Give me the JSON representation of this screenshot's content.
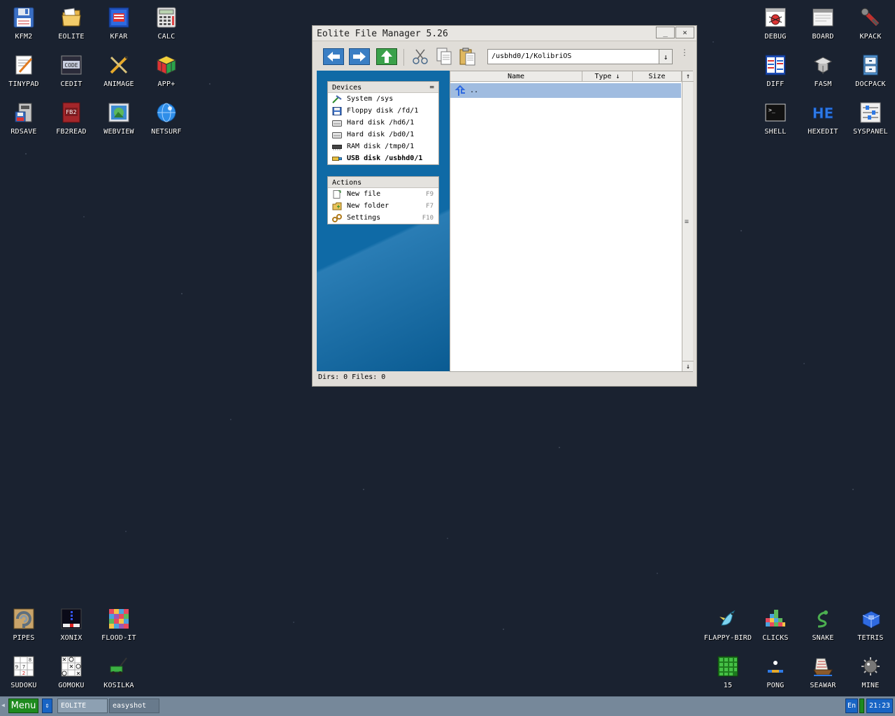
{
  "desktop": {
    "icons": [
      {
        "label": "KFM2",
        "icon": "floppy-disk-icon"
      },
      {
        "label": "EOLITE",
        "icon": "folder-icon"
      },
      {
        "label": "KFAR",
        "icon": "archive-icon"
      },
      {
        "label": "CALC",
        "icon": "calculator-icon"
      },
      {
        "label": "TINYPAD",
        "icon": "notepad-icon"
      },
      {
        "label": "CEDIT",
        "icon": "code-editor-icon"
      },
      {
        "label": "ANIMAGE",
        "icon": "paint-tools-icon"
      },
      {
        "label": "APP+",
        "icon": "rubik-cube-icon"
      },
      {
        "label": "RDSAVE",
        "icon": "ram-disk-save-icon"
      },
      {
        "label": "FB2READ",
        "icon": "book-reader-icon"
      },
      {
        "label": "WEBVIEW",
        "icon": "web-view-icon"
      },
      {
        "label": "NETSURF",
        "icon": "globe-icon"
      },
      {
        "label": "DEBUG",
        "icon": "bug-icon"
      },
      {
        "label": "BOARD",
        "icon": "board-window-icon"
      },
      {
        "label": "KPACK",
        "icon": "wrench-pack-icon"
      },
      {
        "label": "DIFF",
        "icon": "diff-icon"
      },
      {
        "label": "FASM",
        "icon": "assembler-icon"
      },
      {
        "label": "DOCPACK",
        "icon": "file-cabinet-icon"
      },
      {
        "label": "SHELL",
        "icon": "terminal-icon"
      },
      {
        "label": "HEXEDIT",
        "icon": "hex-editor-icon"
      },
      {
        "label": "SYSPANEL",
        "icon": "sliders-icon"
      },
      {
        "label": "PIPES",
        "icon": "pipes-game-icon"
      },
      {
        "label": "XONIX",
        "icon": "xonix-game-icon"
      },
      {
        "label": "FLOOD-IT",
        "icon": "flood-it-game-icon"
      },
      {
        "label": "SUDOKU",
        "icon": "sudoku-game-icon"
      },
      {
        "label": "GOMOKU",
        "icon": "gomoku-game-icon"
      },
      {
        "label": "KOSILKA",
        "icon": "lawn-mower-icon"
      },
      {
        "label": "FLAPPY-BIRD",
        "icon": "bird-icon"
      },
      {
        "label": "CLICKS",
        "icon": "clicks-game-icon"
      },
      {
        "label": "SNAKE",
        "icon": "snake-icon"
      },
      {
        "label": "TETRIS",
        "icon": "tetris-icon"
      },
      {
        "label": "15",
        "icon": "fifteen-puzzle-icon"
      },
      {
        "label": "PONG",
        "icon": "pong-icon"
      },
      {
        "label": "SEAWAR",
        "icon": "ship-icon"
      },
      {
        "label": "MINE",
        "icon": "mine-icon"
      }
    ]
  },
  "window": {
    "title": "Eolite File Manager 5.26",
    "min_label": "_",
    "close_label": "×",
    "path": "/usbhd0/1/KolibriOS",
    "path_drop": "↓",
    "menu_dots": "⋮"
  },
  "devices": {
    "header": "Devices",
    "header_btn": "=",
    "items": [
      {
        "label": "System /sys",
        "icon": "system-icon",
        "bold": false
      },
      {
        "label": "Floppy disk /fd/1",
        "icon": "floppy-icon",
        "bold": false
      },
      {
        "label": "Hard disk /hd6/1",
        "icon": "hard-disk-icon",
        "bold": false
      },
      {
        "label": "Hard disk /bd0/1",
        "icon": "hard-disk-icon",
        "bold": false
      },
      {
        "label": "RAM disk /tmp0/1",
        "icon": "ram-chip-icon",
        "bold": false
      },
      {
        "label": "USB disk /usbhd0/1",
        "icon": "usb-icon",
        "bold": true
      }
    ]
  },
  "actions": {
    "header": "Actions",
    "items": [
      {
        "label": "New file",
        "key": "F9",
        "icon": "new-file-icon"
      },
      {
        "label": "New folder",
        "key": "F7",
        "icon": "new-folder-icon"
      },
      {
        "label": "Settings",
        "key": "F10",
        "icon": "settings-icon"
      }
    ]
  },
  "file_list": {
    "columns": [
      "Name",
      "Type ↓",
      "Size"
    ],
    "scroll_up": "↑",
    "scroll_down": "↓",
    "scroll_grip": "≡",
    "rows": [
      {
        "name": ".."
      }
    ]
  },
  "status": {
    "text": "Dirs: 0  Files: 0"
  },
  "taskbar": {
    "menu_label": "Menu",
    "switch_label": "⇕",
    "left_arrow": "◀",
    "tasks": [
      "EOLITE",
      "easyshot"
    ],
    "lang": "En",
    "clock": "21:23"
  },
  "colors": {
    "desktop_bg": "#1a2230",
    "panel_blue": "#0f6aa6",
    "selection": "#a0bce0",
    "taskbar": "#76889a",
    "menu_green": "#1e8a1e",
    "accent_blue": "#1864c4"
  }
}
